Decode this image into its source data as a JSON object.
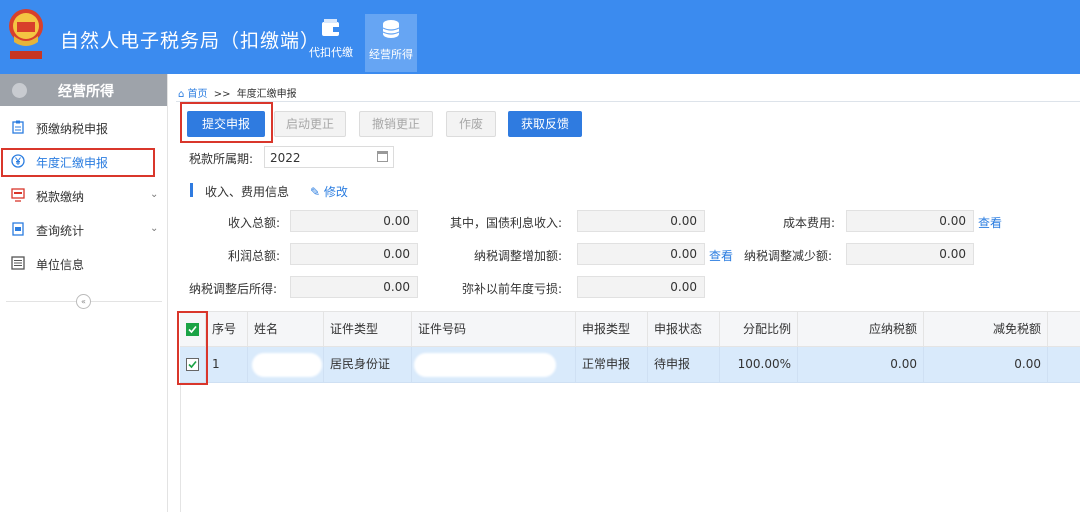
{
  "header": {
    "title": "自然人电子税务局（扣缴端）",
    "nav": [
      {
        "label": "代扣代缴",
        "icon": "wallet-icon"
      },
      {
        "label": "经营所得",
        "icon": "coins-icon",
        "active": true
      }
    ],
    "colors": {
      "bar": "#3b8bef",
      "active_tile": "#66a5f3"
    }
  },
  "sidebar": {
    "heading": "经营所得",
    "items": [
      {
        "label": "预缴纳税申报",
        "icon": "clipboard-icon"
      },
      {
        "label": "年度汇缴申报",
        "icon": "yen-circle-icon",
        "active": true
      },
      {
        "label": "税款缴纳",
        "icon": "monitor-icon",
        "expandable": true
      },
      {
        "label": "查询统计",
        "icon": "document-icon",
        "expandable": true
      },
      {
        "label": "单位信息",
        "icon": "list-icon"
      }
    ]
  },
  "breadcrumb": {
    "home": "首页",
    "separator": ">>",
    "current": "年度汇缴申报"
  },
  "toolbar": {
    "submit": "提交申报",
    "start_correction": "启动更正",
    "cancel_correction": "撤销更正",
    "void": "作废",
    "get_feedback": "获取反馈"
  },
  "period": {
    "label": "税款所属期:",
    "value": "2022"
  },
  "income_section": {
    "title": "收入、费用信息",
    "edit": "修改",
    "fields": {
      "total_income": {
        "label": "收入总额:",
        "value": "0.00"
      },
      "bond_interest": {
        "label": "其中，国债利息收入:",
        "value": "0.00"
      },
      "cost": {
        "label": "成本费用:",
        "value": "0.00",
        "link": "查看"
      },
      "total_profit": {
        "label": "利润总额:",
        "value": "0.00"
      },
      "tax_adj_increase": {
        "label": "纳税调整增加额:",
        "value": "0.00",
        "link": "查看"
      },
      "tax_adj_decrease": {
        "label": "纳税调整减少额:",
        "value": "0.00"
      },
      "adjusted_income": {
        "label": "纳税调整后所得:",
        "value": "0.00"
      },
      "prior_losses": {
        "label": "弥补以前年度亏损:",
        "value": "0.00"
      }
    }
  },
  "table": {
    "columns": [
      "序号",
      "姓名",
      "证件类型",
      "证件号码",
      "申报类型",
      "申报状态",
      "分配比例",
      "应纳税额",
      "减免税额"
    ],
    "rows": [
      {
        "no": "1",
        "name": "",
        "id_type": "居民身份证",
        "id_number": "",
        "declare_type": "正常申报",
        "status": "待申报",
        "ratio": "100.00%",
        "tax_payable": "0.00",
        "tax_relief": "0.00",
        "checked": true
      }
    ],
    "header_checked": true
  }
}
